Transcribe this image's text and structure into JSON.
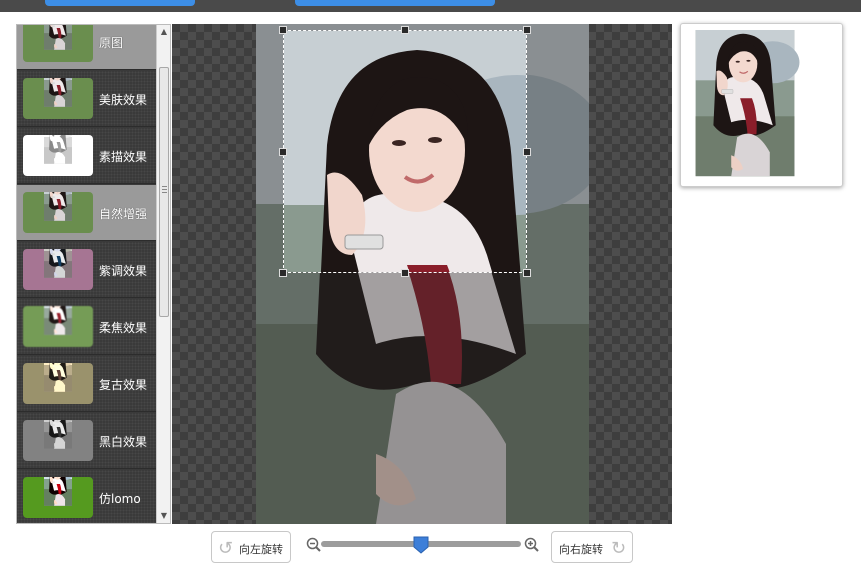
{
  "effects": [
    {
      "label": "原图",
      "selected": true
    },
    {
      "label": "美肤效果",
      "selected": false
    },
    {
      "label": "素描效果",
      "selected": false
    },
    {
      "label": "自然增强",
      "selected": true
    },
    {
      "label": "紫调效果",
      "selected": false
    },
    {
      "label": "柔焦效果",
      "selected": false
    },
    {
      "label": "复古效果",
      "selected": false
    },
    {
      "label": "黑白效果",
      "selected": false
    },
    {
      "label": "仿lomo",
      "selected": false
    }
  ],
  "toolbar": {
    "rotate_left": "向左旋转",
    "rotate_right": "向右旋转",
    "zoom": 0.5
  },
  "colors": {
    "accent": "#3d8ee6",
    "panel_dark": "#3a3a3a",
    "selected_row": "#9a9a9a"
  },
  "icons": {
    "zoom_out": "zoom-out-icon",
    "zoom_in": "zoom-in-icon",
    "rotate_left": "rotate-left-icon",
    "rotate_right": "rotate-right-icon"
  }
}
